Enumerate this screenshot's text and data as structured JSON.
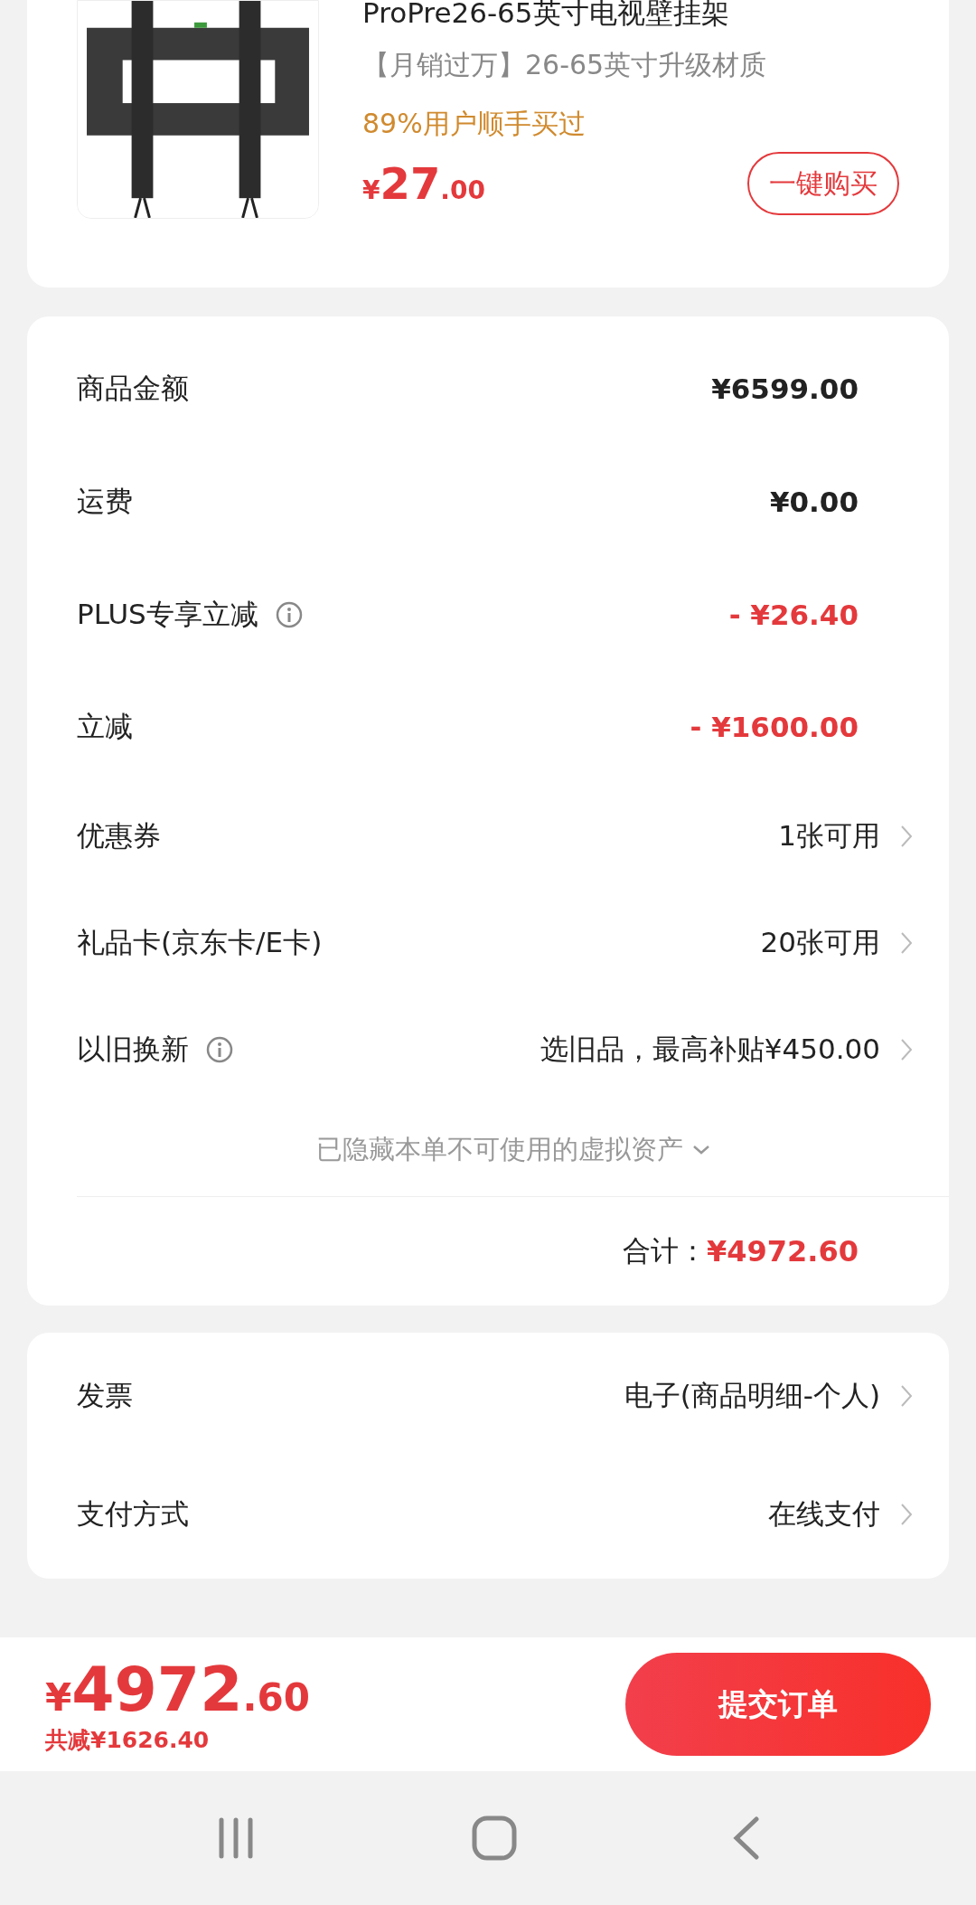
{
  "product": {
    "title": "ProPre26-65英寸电视壁挂架",
    "subtitle": "【月销过万】26-65英寸升级材质",
    "social_proof": "89%用户顺手买过",
    "price_symbol": "¥",
    "price_int": "27",
    "price_dec": ".00",
    "button": "一键购买"
  },
  "summary": {
    "rows": [
      {
        "kind": "amount",
        "label": "商品金额",
        "value": "¥6599.00",
        "info": false
      },
      {
        "kind": "amount",
        "label": "运费",
        "value": "¥0.00",
        "info": false
      },
      {
        "kind": "discount",
        "label": "PLUS专享立减",
        "value": "- ¥26.40",
        "info": true
      },
      {
        "kind": "discount",
        "label": "立减",
        "value": "- ¥1600.00",
        "info": false
      },
      {
        "kind": "link",
        "label": "优惠券",
        "value": "1张可用",
        "info": false
      },
      {
        "kind": "link",
        "label": "礼品卡(京东卡/E卡)",
        "value": "20张可用",
        "info": false
      },
      {
        "kind": "link",
        "label": "以旧换新",
        "value": "选旧品，最高补贴¥450.00",
        "info": true
      }
    ],
    "hidden_note": "已隐藏本单不可使用的虚拟资产",
    "total_label": "合计：",
    "total_value": "¥4972.60"
  },
  "options": [
    {
      "label": "发票",
      "value": "电子(商品明细-个人)"
    },
    {
      "label": "支付方式",
      "value": "在线支付"
    }
  ],
  "footer": {
    "price_symbol": "¥",
    "price_int": "4972",
    "price_dec": ".60",
    "saving": "共减¥1626.40",
    "submit": "提交订单"
  }
}
